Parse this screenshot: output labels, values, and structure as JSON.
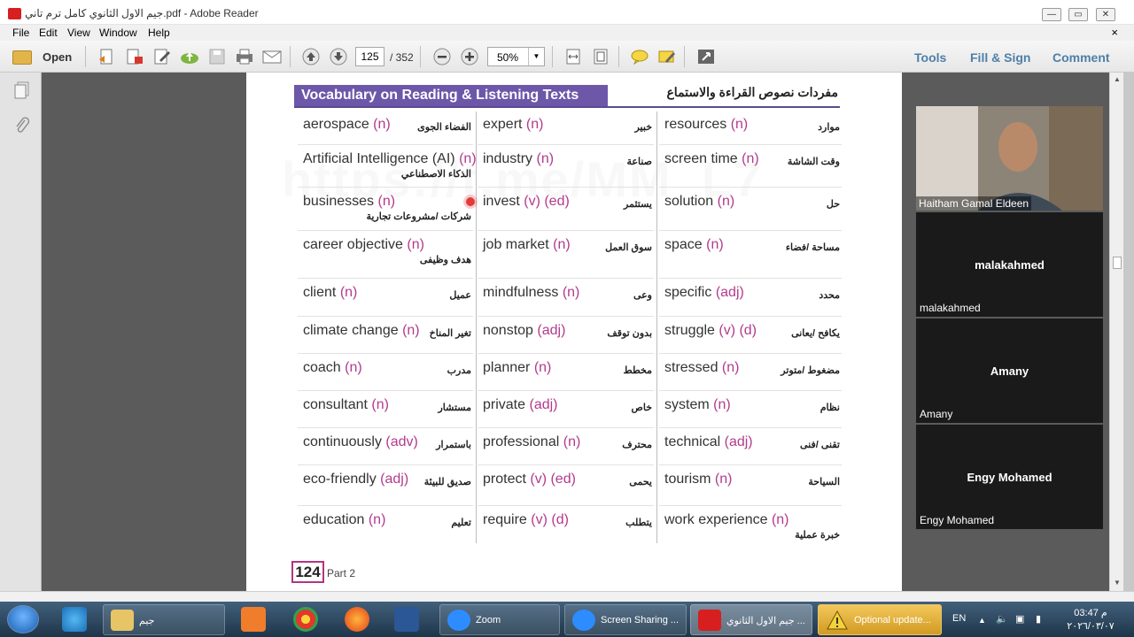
{
  "window": {
    "title": "جيم الاول الثانوي كامل ترم تاني.pdf - Adobe Reader",
    "min": "—",
    "max": "▭",
    "close": "✕"
  },
  "menu": {
    "items": [
      "File",
      "Edit",
      "View",
      "Window",
      "Help"
    ],
    "close_doc": "×"
  },
  "toolbar": {
    "open_label": "Open",
    "page_current": "125",
    "page_total": "/ 352",
    "zoom": "50%",
    "tools_label": "Tools",
    "fill_sign_label": "Fill & Sign",
    "comment_label": "Comment"
  },
  "document": {
    "header_en": "Vocabulary on Reading & Listening Texts",
    "header_ar": "مفردات نصوص القراءة والاستماع",
    "watermark": "https://t.me/MM_L7",
    "page_number": "124",
    "part": "Part 2",
    "columns": [
      [
        {
          "word": "aerospace",
          "pos": "(n)",
          "ar": "الفضاء الجوى"
        },
        {
          "word": "Artificial Intelligence (AI)",
          "pos": "(n)",
          "ar": "",
          "ar_sub": "الذكاء الاصطناعي"
        },
        {
          "word": "businesses",
          "pos": "(n)",
          "ar": "",
          "ar_sub": "شركات /مشروعات تجارية"
        },
        {
          "word": "career objective",
          "pos": "(n)",
          "ar": "",
          "ar_sub": "هدف وظيفى"
        },
        {
          "word": "client",
          "pos": "(n)",
          "ar": "عميل"
        },
        {
          "word": "climate change",
          "pos": "(n)",
          "ar": "تغير المناخ"
        },
        {
          "word": "coach",
          "pos": "(n)",
          "ar": "مدرب"
        },
        {
          "word": "consultant",
          "pos": "(n)",
          "ar": "مستشار"
        },
        {
          "word": "continuously",
          "pos": "(adv)",
          "ar": "باستمرار"
        },
        {
          "word": "eco-friendly",
          "pos": "(adj)",
          "ar": "صديق للبيئة"
        },
        {
          "word": "education",
          "pos": "(n)",
          "ar": "تعليم"
        }
      ],
      [
        {
          "word": "expert",
          "pos": "(n)",
          "ar": "خبير"
        },
        {
          "word": "industry",
          "pos": "(n)",
          "ar": "صناعة"
        },
        {
          "word": "invest",
          "pos": "(v) (ed)",
          "ar": "يستثمر"
        },
        {
          "word": "job market",
          "pos": "(n)",
          "ar": "سوق العمل"
        },
        {
          "word": "mindfulness",
          "pos": "(n)",
          "ar": "وعى"
        },
        {
          "word": "nonstop",
          "pos": "(adj)",
          "ar": "بدون توقف"
        },
        {
          "word": "planner",
          "pos": "(n)",
          "ar": "مخطط"
        },
        {
          "word": "private",
          "pos": "(adj)",
          "ar": "خاص"
        },
        {
          "word": "professional",
          "pos": "(n)",
          "ar": "محترف"
        },
        {
          "word": "protect",
          "pos": "(v) (ed)",
          "ar": "يحمى"
        },
        {
          "word": "require",
          "pos": "(v) (d)",
          "ar": "يتطلب"
        }
      ],
      [
        {
          "word": "resources",
          "pos": "(n)",
          "ar": "موارد"
        },
        {
          "word": "screen time",
          "pos": "(n)",
          "ar": "وقت الشاشة"
        },
        {
          "word": "solution",
          "pos": "(n)",
          "ar": "حل"
        },
        {
          "word": "space",
          "pos": "(n)",
          "ar": "مساحة /فضاء"
        },
        {
          "word": "specific",
          "pos": "(adj)",
          "ar": "محدد"
        },
        {
          "word": "struggle",
          "pos": "(v) (d)",
          "ar": "يكافح /يعانى"
        },
        {
          "word": "stressed",
          "pos": "(n)",
          "ar": "مضغوط /متوتر"
        },
        {
          "word": "system",
          "pos": "(n)",
          "ar": "نظام"
        },
        {
          "word": "technical",
          "pos": "(adj)",
          "ar": "تقنى /فنى"
        },
        {
          "word": "tourism",
          "pos": "(n)",
          "ar": "السياحة"
        },
        {
          "word": "work experience",
          "pos": "(n)",
          "ar": "",
          "ar_sub": "خبرة عملية"
        }
      ]
    ]
  },
  "participants": [
    {
      "name": "Haitham Gamal Eldeen",
      "video": true
    },
    {
      "name": "malakahmed",
      "video": false
    },
    {
      "name": "Amany",
      "video": false
    },
    {
      "name": "Engy Mohamed",
      "video": false
    }
  ],
  "taskbar": {
    "folder_label": "جيم",
    "zoom_label": "Zoom",
    "screen_sharing_label": "Screen Sharing ...",
    "pdf_label": "جيم الاول الثانوي ...",
    "update_label": "Optional update...",
    "lang": "EN",
    "time": "03:47 م",
    "date": "٢٠٢٦/٠٣/٠٧"
  },
  "colors": {
    "header_bg": "#6c57a9",
    "pos": "#b33a8c",
    "link": "#4e7fa8"
  }
}
